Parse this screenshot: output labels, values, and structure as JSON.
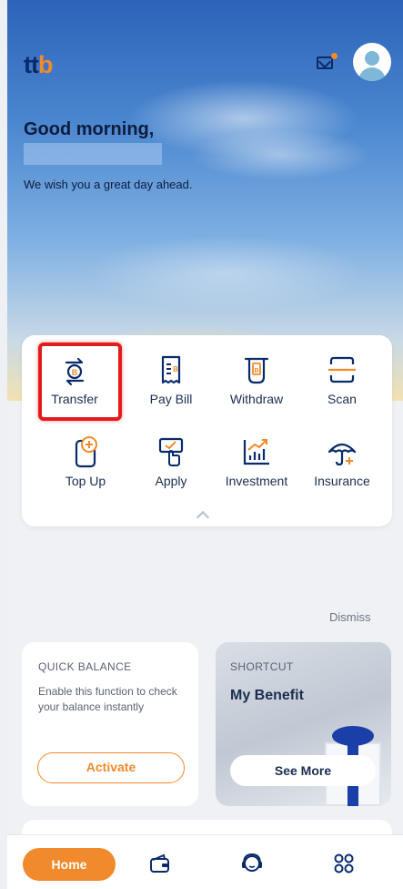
{
  "header": {
    "logo_text_a": "tt",
    "logo_text_b": "b",
    "greeting": "Good morning,",
    "subtitle": "We wish you a great day ahead."
  },
  "menu": {
    "items": [
      {
        "label": "Transfer",
        "icon": "transfer-icon"
      },
      {
        "label": "Pay Bill",
        "icon": "pay-bill-icon"
      },
      {
        "label": "Withdraw",
        "icon": "withdraw-icon"
      },
      {
        "label": "Scan",
        "icon": "scan-icon"
      },
      {
        "label": "Top Up",
        "icon": "top-up-icon"
      },
      {
        "label": "Apply",
        "icon": "apply-icon"
      },
      {
        "label": "Investment",
        "icon": "investment-icon"
      },
      {
        "label": "Insurance",
        "icon": "insurance-icon"
      }
    ]
  },
  "dismiss_label": "Dismiss",
  "quick_balance": {
    "title": "QUICK BALANCE",
    "description": "Enable this function to check your balance instantly",
    "button": "Activate"
  },
  "shortcut": {
    "title": "SHORTCUT",
    "heading": "My Benefit",
    "button": "See More"
  },
  "bottom_nav": {
    "home_label": "Home",
    "icons": [
      "wallet-icon",
      "support-agent-icon",
      "apps-grid-icon"
    ]
  },
  "colors": {
    "brand_orange": "#f08a2c",
    "brand_navy": "#0a2b6b",
    "highlight_red": "#e41b1b"
  }
}
